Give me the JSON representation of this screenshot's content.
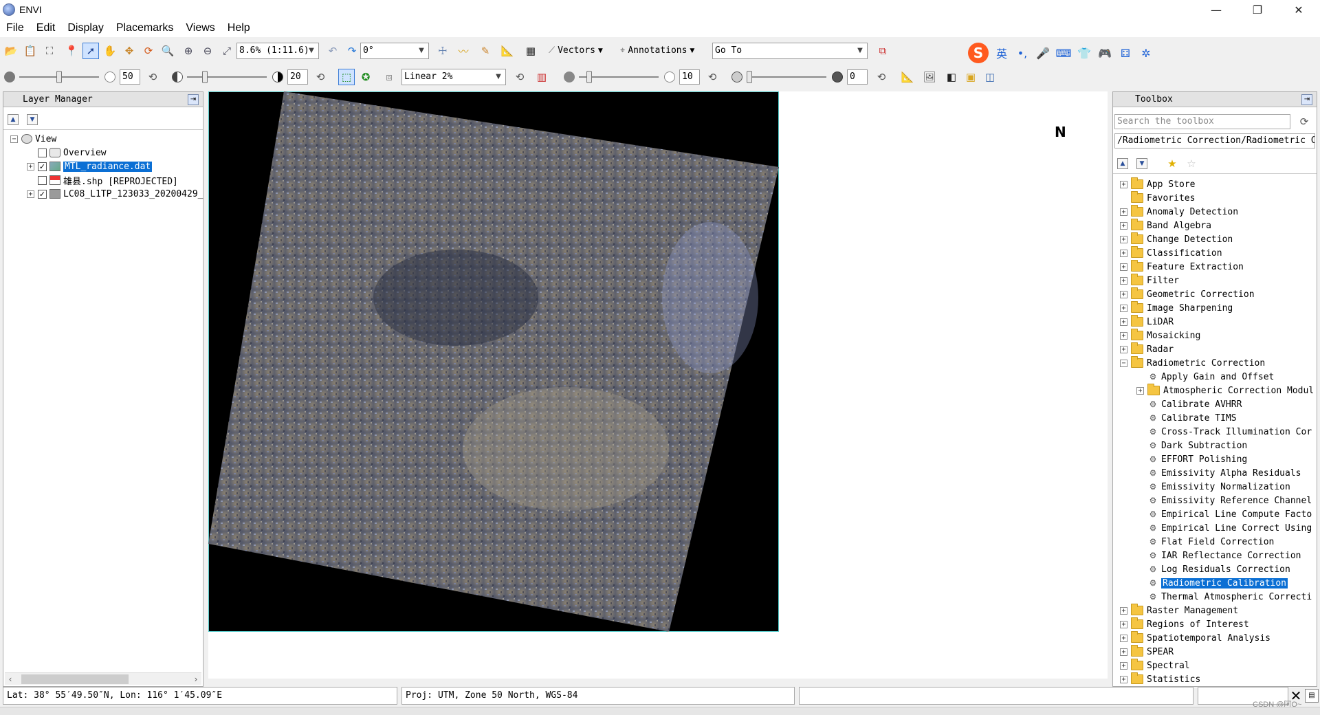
{
  "window": {
    "title": "ENVI",
    "minimize": "—",
    "maximize": "❐",
    "close": "✕"
  },
  "menu": [
    "File",
    "Edit",
    "Display",
    "Placemarks",
    "Views",
    "Help"
  ],
  "toolbar1": {
    "zoom_value": "8.6% (1:11.6)",
    "rotation_value": "0°",
    "vectors_label": "Vectors",
    "annotations_label": "Annotations",
    "goto_value": "Go To"
  },
  "toolbar2": {
    "brightness_value": "50",
    "contrast_value": "20",
    "stretch_value": "Linear 2%",
    "sharpen_value": "10",
    "transparency_value": "0",
    "sliders": {
      "brightness": 0.5,
      "contrast": 0.2,
      "sharpen": 0.1,
      "transparency": 0
    }
  },
  "ime": {
    "logo": "S",
    "lang": "英",
    "punct": "•,",
    "mic": "🎤",
    "keyboard": "⌨",
    "skin": "👕",
    "game": "🎮",
    "apps": "⚃",
    "settings": "✲"
  },
  "layer_manager": {
    "title": "Layer Manager",
    "tree": [
      {
        "label": "View",
        "level": 0,
        "expander": "−",
        "checkbox": null,
        "icon": "view"
      },
      {
        "label": "Overview",
        "level": 1,
        "expander": "",
        "checkbox": false,
        "icon": "overview"
      },
      {
        "label": "MTL_radiance.dat",
        "level": 1,
        "expander": "+",
        "checkbox": true,
        "icon": "raster",
        "selected": true
      },
      {
        "label": "雄县.shp [REPROJECTED]",
        "level": 1,
        "expander": "",
        "checkbox": false,
        "icon": "vector"
      },
      {
        "label": "LC08_L1TP_123033_20200429_",
        "level": 1,
        "expander": "+",
        "checkbox": true,
        "icon": "raster-gray"
      }
    ]
  },
  "toolbox": {
    "title": "Toolbox",
    "search_placeholder": "Search the toolbox",
    "path": "/Radiometric Correction/Radiometric Ca",
    "items": [
      {
        "label": "App Store",
        "level": 0,
        "type": "folder",
        "expander": "+"
      },
      {
        "label": "Favorites",
        "level": 0,
        "type": "folder",
        "expander": ""
      },
      {
        "label": "Anomaly Detection",
        "level": 0,
        "type": "folder",
        "expander": "+"
      },
      {
        "label": "Band Algebra",
        "level": 0,
        "type": "folder",
        "expander": "+"
      },
      {
        "label": "Change Detection",
        "level": 0,
        "type": "folder",
        "expander": "+"
      },
      {
        "label": "Classification",
        "level": 0,
        "type": "folder",
        "expander": "+"
      },
      {
        "label": "Feature Extraction",
        "level": 0,
        "type": "folder",
        "expander": "+"
      },
      {
        "label": "Filter",
        "level": 0,
        "type": "folder",
        "expander": "+"
      },
      {
        "label": "Geometric Correction",
        "level": 0,
        "type": "folder",
        "expander": "+"
      },
      {
        "label": "Image Sharpening",
        "level": 0,
        "type": "folder",
        "expander": "+"
      },
      {
        "label": "LiDAR",
        "level": 0,
        "type": "folder",
        "expander": "+"
      },
      {
        "label": "Mosaicking",
        "level": 0,
        "type": "folder",
        "expander": "+"
      },
      {
        "label": "Radar",
        "level": 0,
        "type": "folder",
        "expander": "+"
      },
      {
        "label": "Radiometric Correction",
        "level": 0,
        "type": "folder",
        "expander": "−"
      },
      {
        "label": "Apply Gain and Offset",
        "level": 1,
        "type": "tool",
        "expander": ""
      },
      {
        "label": "Atmospheric Correction Modul",
        "level": 1,
        "type": "folder",
        "expander": "+"
      },
      {
        "label": "Calibrate AVHRR",
        "level": 1,
        "type": "tool",
        "expander": ""
      },
      {
        "label": "Calibrate TIMS",
        "level": 1,
        "type": "tool",
        "expander": ""
      },
      {
        "label": "Cross-Track Illumination Cor",
        "level": 1,
        "type": "tool",
        "expander": ""
      },
      {
        "label": "Dark Subtraction",
        "level": 1,
        "type": "tool",
        "expander": ""
      },
      {
        "label": "EFFORT Polishing",
        "level": 1,
        "type": "tool",
        "expander": ""
      },
      {
        "label": "Emissivity Alpha Residuals",
        "level": 1,
        "type": "tool",
        "expander": ""
      },
      {
        "label": "Emissivity Normalization",
        "level": 1,
        "type": "tool",
        "expander": ""
      },
      {
        "label": "Emissivity Reference Channel",
        "level": 1,
        "type": "tool",
        "expander": ""
      },
      {
        "label": "Empirical Line Compute Facto",
        "level": 1,
        "type": "tool",
        "expander": ""
      },
      {
        "label": "Empirical Line Correct Using",
        "level": 1,
        "type": "tool",
        "expander": ""
      },
      {
        "label": "Flat Field Correction",
        "level": 1,
        "type": "tool",
        "expander": ""
      },
      {
        "label": "IAR Reflectance Correction",
        "level": 1,
        "type": "tool",
        "expander": ""
      },
      {
        "label": "Log Residuals Correction",
        "level": 1,
        "type": "tool",
        "expander": ""
      },
      {
        "label": "Radiometric Calibration",
        "level": 1,
        "type": "tool",
        "expander": "",
        "selected": true
      },
      {
        "label": "Thermal Atmospheric Correcti",
        "level": 1,
        "type": "tool",
        "expander": ""
      },
      {
        "label": "Raster Management",
        "level": 0,
        "type": "folder",
        "expander": "+"
      },
      {
        "label": "Regions of Interest",
        "level": 0,
        "type": "folder",
        "expander": "+"
      },
      {
        "label": "Spatiotemporal Analysis",
        "level": 0,
        "type": "folder",
        "expander": "+"
      },
      {
        "label": "SPEAR",
        "level": 0,
        "type": "folder",
        "expander": "+"
      },
      {
        "label": "Spectral",
        "level": 0,
        "type": "folder",
        "expander": "+"
      },
      {
        "label": "Statistics",
        "level": 0,
        "type": "folder",
        "expander": "+"
      }
    ]
  },
  "view": {
    "north_arrow": "N"
  },
  "status": {
    "latlon": "Lat: 38° 55′49.50″N, Lon: 116° 1′45.09″E",
    "projection": "Proj: UTM, Zone 50 North, WGS-84",
    "empty": "",
    "watermark": "CSDN @阿Q~"
  }
}
